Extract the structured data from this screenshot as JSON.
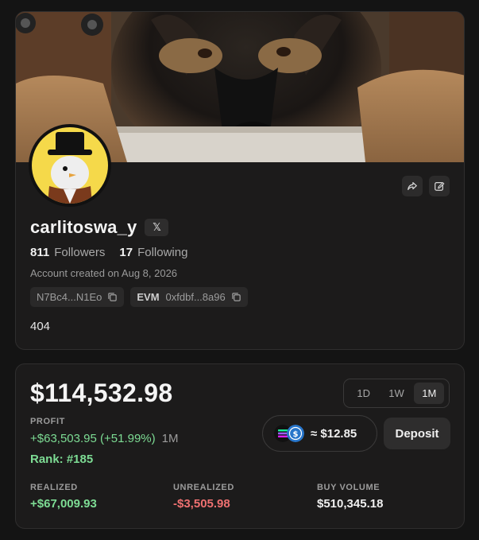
{
  "profile": {
    "username": "carlitoswa_y",
    "x_badge": "𝕏",
    "followers_count": "811",
    "followers_label": "Followers",
    "following_count": "17",
    "following_label": "Following",
    "created": "Account created on Aug 8, 2026",
    "addresses": [
      {
        "tag": "",
        "value": "N7Bc4...N1Eo"
      },
      {
        "tag": "EVM",
        "value": "0xfdbf...8a96"
      }
    ],
    "bio": "404",
    "icons": {
      "share": "share-icon",
      "edit": "edit-icon",
      "copy": "copy-icon"
    }
  },
  "stats": {
    "total_value": "$114,532.98",
    "ranges": [
      "1D",
      "1W",
      "1M"
    ],
    "active_range": "1M",
    "profit_label": "PROFIT",
    "profit_value": "+$63,503.95 (+51.99%)",
    "profit_period": "1M",
    "rank": "Rank: #185",
    "token_price": "≈ $12.85",
    "deposit_label": "Deposit",
    "metrics": [
      {
        "label": "REALIZED",
        "value": "+$67,009.93"
      },
      {
        "label": "UNREALIZED",
        "value": "-$3,505.98"
      },
      {
        "label": "BUY VOLUME",
        "value": "$510,345.18"
      }
    ]
  },
  "colors": {
    "background": "#141414",
    "card": "#1c1b1b",
    "positive": "#7ddc94",
    "negative": "#ef7171"
  }
}
